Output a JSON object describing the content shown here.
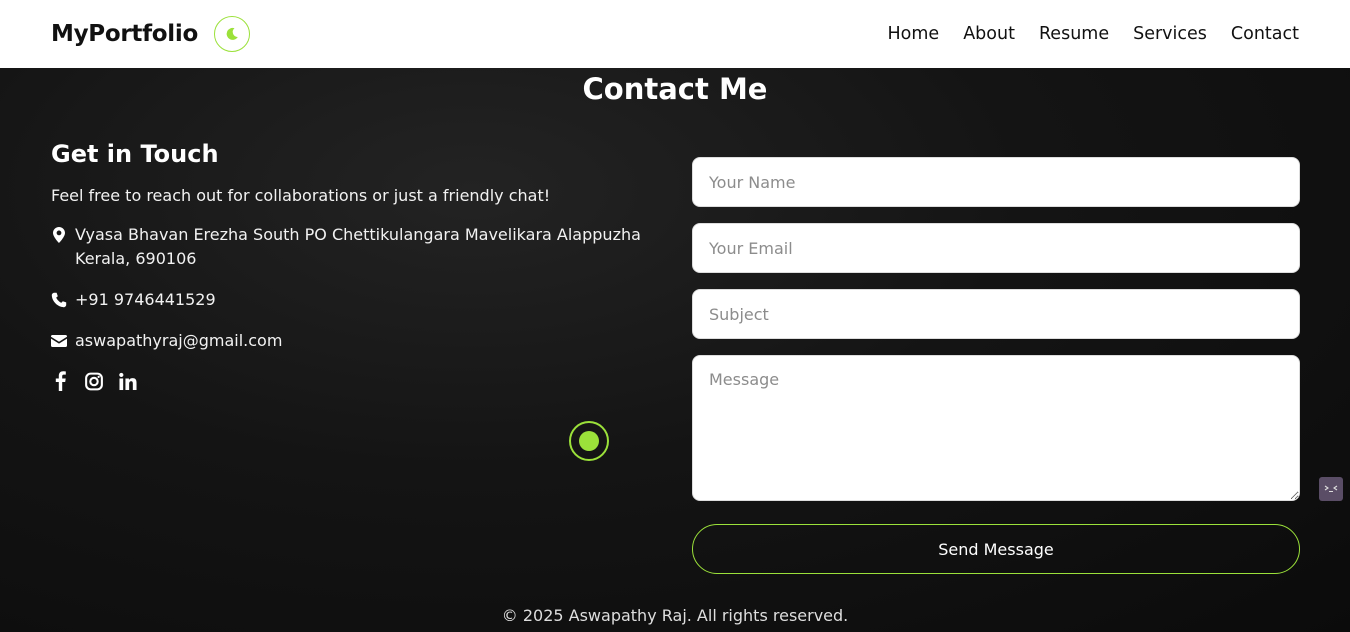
{
  "nav": {
    "logo": "MyPortfolio",
    "links": [
      "Home",
      "About",
      "Resume",
      "Services",
      "Contact"
    ]
  },
  "section_title": "Contact Me",
  "contact": {
    "heading": "Get in Touch",
    "intro": "Feel free to reach out for collaborations or just a friendly chat!",
    "address": "Vyasa Bhavan Erezha South PO Chettikulangara Mavelikara Alappuzha Kerala, 690106",
    "phone": "+91 9746441529",
    "email": "aswapathyraj@gmail.com",
    "socials": [
      "facebook-icon",
      "instagram-icon",
      "linkedin-icon"
    ]
  },
  "form": {
    "name_placeholder": "Your Name",
    "email_placeholder": "Your Email",
    "subject_placeholder": "Subject",
    "message_placeholder": "Message",
    "submit_label": "Send Message"
  },
  "footer": "© 2025 Aswapathy Raj. All rights reserved.",
  "colors": {
    "accent": "#9be13a",
    "background": "#141414",
    "navbar": "#ffffff"
  }
}
